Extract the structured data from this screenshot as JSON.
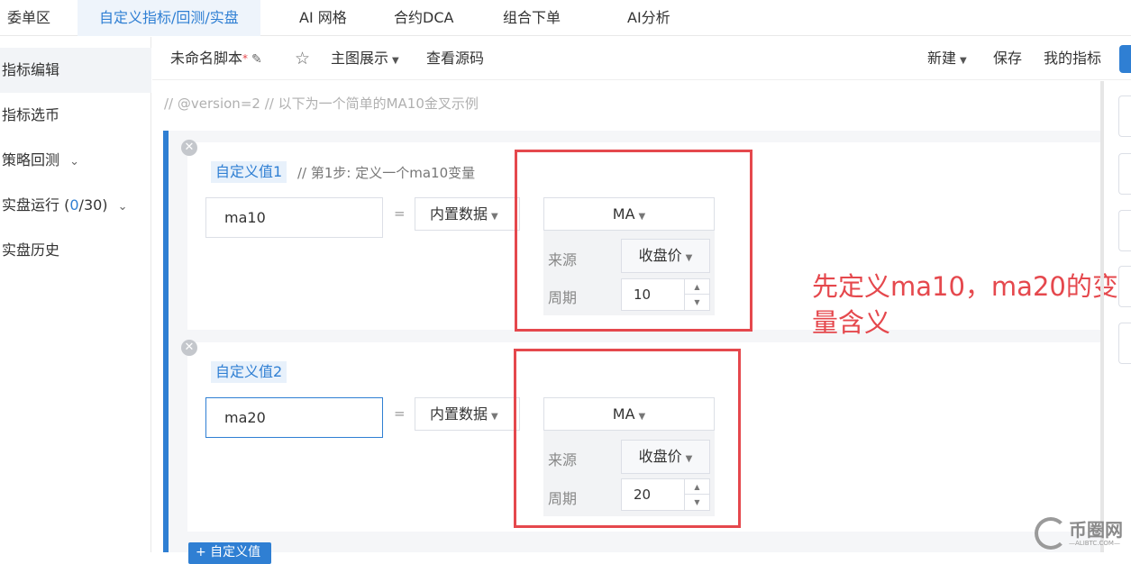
{
  "top_tabs": [
    {
      "label": "委单区"
    },
    {
      "label": "自定义指标/回测/实盘"
    },
    {
      "label": "AI 网格"
    },
    {
      "label": "合约DCA"
    },
    {
      "label": "组合下单"
    },
    {
      "label": "AI分析"
    }
  ],
  "sidebar": {
    "items": [
      {
        "label": "指标编辑"
      },
      {
        "label": "指标选币"
      },
      {
        "label": "策略回测"
      },
      {
        "label": "实盘运行",
        "count_prefix": "(",
        "count_used": "0",
        "count_total": "/30)"
      },
      {
        "label": "实盘历史"
      }
    ]
  },
  "toolbar": {
    "script_name": "未命名脚本",
    "unsaved_mark": "*",
    "main_chart": "主图展示",
    "view_source": "查看源码",
    "new": "新建",
    "save": "保存",
    "my_indicators": "我的指标"
  },
  "editor": {
    "version_comment": "// @version=2 // 以下为一个简单的MA10金叉示例",
    "definitions": [
      {
        "tag": "自定义值1",
        "comment": "// 第1步: 定义一个ma10变量",
        "name": "ma10",
        "equals": "=",
        "source_type": "内置数据",
        "function": "MA",
        "source_label": "来源",
        "source_value": "收盘价",
        "period_label": "周期",
        "period_value": "10"
      },
      {
        "tag": "自定义值2",
        "comment": "",
        "name": "ma20",
        "equals": "=",
        "source_type": "内置数据",
        "function": "MA",
        "source_label": "来源",
        "source_value": "收盘价",
        "period_label": "周期",
        "period_value": "20"
      }
    ],
    "add_button": "+ 自定义值"
  },
  "annotation": {
    "line1": "先定义ma10，ma20的变",
    "line2": "量含义",
    "color": "#e5484d"
  },
  "watermark": {
    "brand": "币圈网",
    "url": "—ALIBTC.COM—"
  },
  "colors": {
    "accent": "#2f7fd3",
    "annotation": "#e5484d"
  }
}
